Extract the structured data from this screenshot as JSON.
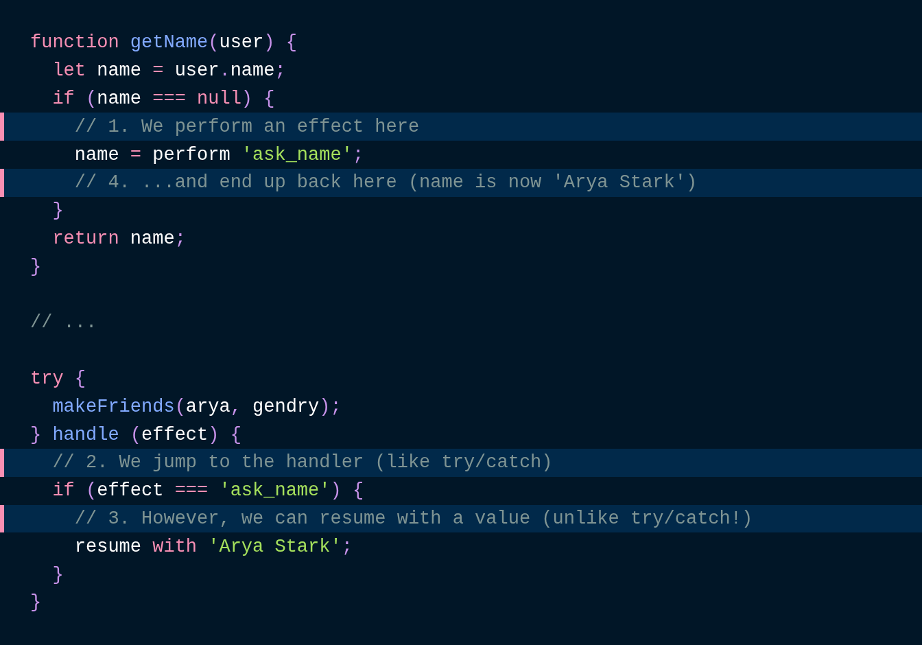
{
  "code_lines": [
    {
      "highlighted": false,
      "tokens": [
        {
          "kind": "keyword",
          "text": "function "
        },
        {
          "kind": "function",
          "text": "getName"
        },
        {
          "kind": "punct",
          "text": "("
        },
        {
          "kind": "plain",
          "text": "user"
        },
        {
          "kind": "punct",
          "text": ") {"
        }
      ]
    },
    {
      "highlighted": false,
      "tokens": [
        {
          "kind": "keyword",
          "text": "  let"
        },
        {
          "kind": "plain",
          "text": " name "
        },
        {
          "kind": "keyword",
          "text": "="
        },
        {
          "kind": "plain",
          "text": " user"
        },
        {
          "kind": "punct",
          "text": "."
        },
        {
          "kind": "plain",
          "text": "name"
        },
        {
          "kind": "punct",
          "text": ";"
        }
      ]
    },
    {
      "highlighted": false,
      "tokens": [
        {
          "kind": "keyword",
          "text": "  if "
        },
        {
          "kind": "punct",
          "text": "("
        },
        {
          "kind": "plain",
          "text": "name "
        },
        {
          "kind": "keyword",
          "text": "=== null"
        },
        {
          "kind": "punct",
          "text": ") {"
        }
      ]
    },
    {
      "highlighted": true,
      "tokens": [
        {
          "kind": "comment",
          "text": "    // 1. We perform an effect here"
        }
      ]
    },
    {
      "highlighted": false,
      "tokens": [
        {
          "kind": "plain",
          "text": "    name "
        },
        {
          "kind": "keyword",
          "text": "="
        },
        {
          "kind": "plain",
          "text": " perform "
        },
        {
          "kind": "string",
          "text": "'ask_name'"
        },
        {
          "kind": "punct",
          "text": ";"
        }
      ]
    },
    {
      "highlighted": true,
      "tokens": [
        {
          "kind": "comment",
          "text": "    // 4. ...and end up back here (name is now 'Arya Stark')"
        }
      ]
    },
    {
      "highlighted": false,
      "tokens": [
        {
          "kind": "punct",
          "text": "  }"
        }
      ]
    },
    {
      "highlighted": false,
      "tokens": [
        {
          "kind": "keyword",
          "text": "  return"
        },
        {
          "kind": "plain",
          "text": " name"
        },
        {
          "kind": "punct",
          "text": ";"
        }
      ]
    },
    {
      "highlighted": false,
      "tokens": [
        {
          "kind": "punct",
          "text": "}"
        }
      ]
    },
    {
      "highlighted": false
    },
    {
      "highlighted": false,
      "tokens": [
        {
          "kind": "comment",
          "text": "// ..."
        }
      ]
    },
    {
      "highlighted": false
    },
    {
      "highlighted": false,
      "tokens": [
        {
          "kind": "keyword",
          "text": "try "
        },
        {
          "kind": "punct",
          "text": "{"
        }
      ]
    },
    {
      "highlighted": false,
      "tokens": [
        {
          "kind": "function",
          "text": "  makeFriends"
        },
        {
          "kind": "punct",
          "text": "("
        },
        {
          "kind": "plain",
          "text": "arya"
        },
        {
          "kind": "punct",
          "text": ","
        },
        {
          "kind": "plain",
          "text": " gendry"
        },
        {
          "kind": "punct",
          "text": ");"
        }
      ]
    },
    {
      "highlighted": false,
      "tokens": [
        {
          "kind": "punct",
          "text": "} "
        },
        {
          "kind": "function",
          "text": "handle "
        },
        {
          "kind": "punct",
          "text": "("
        },
        {
          "kind": "plain",
          "text": "effect"
        },
        {
          "kind": "punct",
          "text": ") {"
        }
      ]
    },
    {
      "highlighted": true,
      "tokens": [
        {
          "kind": "comment",
          "text": "  // 2. We jump to the handler (like try/catch)"
        }
      ]
    },
    {
      "highlighted": false,
      "tokens": [
        {
          "kind": "keyword",
          "text": "  if "
        },
        {
          "kind": "punct",
          "text": "("
        },
        {
          "kind": "plain",
          "text": "effect "
        },
        {
          "kind": "keyword",
          "text": "=== "
        },
        {
          "kind": "string",
          "text": "'ask_name'"
        },
        {
          "kind": "punct",
          "text": ") {"
        }
      ]
    },
    {
      "highlighted": true,
      "tokens": [
        {
          "kind": "comment",
          "text": "    // 3. However, we can resume with a value (unlike try/catch!)"
        }
      ]
    },
    {
      "highlighted": false,
      "tokens": [
        {
          "kind": "plain",
          "text": "    resume "
        },
        {
          "kind": "keyword",
          "text": "with "
        },
        {
          "kind": "string",
          "text": "'Arya Stark'"
        },
        {
          "kind": "punct",
          "text": ";"
        }
      ]
    },
    {
      "highlighted": false,
      "tokens": [
        {
          "kind": "punct",
          "text": "  }"
        }
      ]
    },
    {
      "highlighted": false,
      "tokens": [
        {
          "kind": "punct",
          "text": "}"
        }
      ]
    }
  ]
}
